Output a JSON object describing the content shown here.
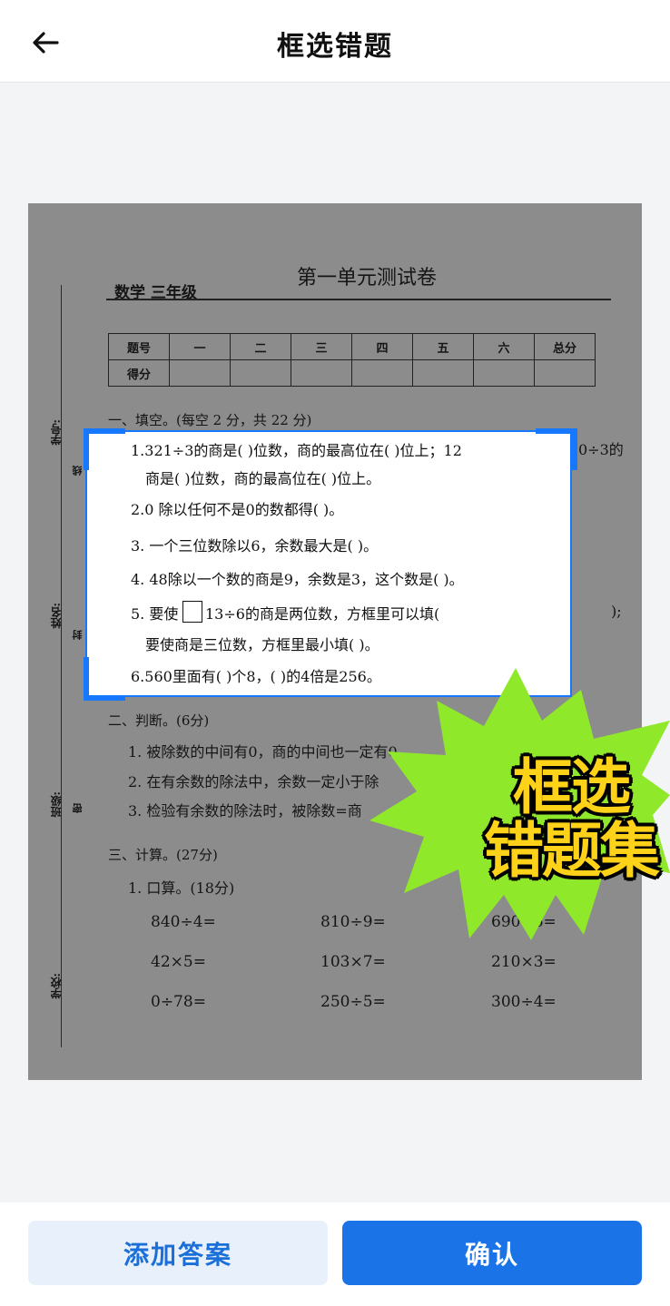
{
  "header": {
    "title": "框选错题"
  },
  "paper": {
    "title": "第一单元测试卷",
    "grade": "数学 三年级",
    "side_labels": {
      "student_no": "学号:",
      "name": "姓名:",
      "class": "班级:",
      "school": "学校:",
      "seal": [
        "线",
        "封",
        "密"
      ]
    },
    "score_table": {
      "row1": [
        "题号",
        "一",
        "二",
        "三",
        "四",
        "五",
        "六",
        "总分"
      ],
      "row2_label": "得分"
    },
    "section1": "一、填空。(每空 2 分，共 22 分)",
    "q1_tail": "0÷3的",
    "q5_tail": ");",
    "section2": "二、判断。(6分)",
    "judge": [
      "1. 被除数的中间有0，商的中间也一定有0",
      "2. 在有余数的除法中，余数一定小于除",
      "3. 检验有余数的除法时，被除数=商"
    ],
    "section3": "三、计算。(27分)",
    "sub1": "1. 口算。(18分)",
    "calc": [
      [
        "840÷4=",
        "810÷9=",
        "690÷6="
      ],
      [
        "42×5=",
        "103×7=",
        "210×3="
      ],
      [
        "0÷78=",
        "250÷5=",
        "300÷4="
      ]
    ]
  },
  "selection": {
    "lines": [
      "1.321÷3的商是(          )位数，商的最高位在(        )位上；12",
      "商是(          )位数，商的最高位在(        )位上。",
      "2.0  除以任何不是0的数都得(          )。",
      "3. 一个三位数除以6，余数最大是(          )。",
      "4. 48除以一个数的商是9，余数是3，这个数是(          )。",
      "5. 要使",
      "13÷6的商是两位数，方框里可以填(",
      "要使商是三位数，方框里最小填(          )。",
      "6.560里面有(          )个8，(          )的4倍是256。"
    ]
  },
  "promo": {
    "line1": "框选",
    "line2": "错题集",
    "burst_color": "#8fe82a",
    "text_color": "#ffd21a"
  },
  "actions": {
    "add_answer": "添加答案",
    "confirm": "确认"
  },
  "colors": {
    "accent": "#1b73e8",
    "secondary_bg": "#e8f0fb"
  }
}
